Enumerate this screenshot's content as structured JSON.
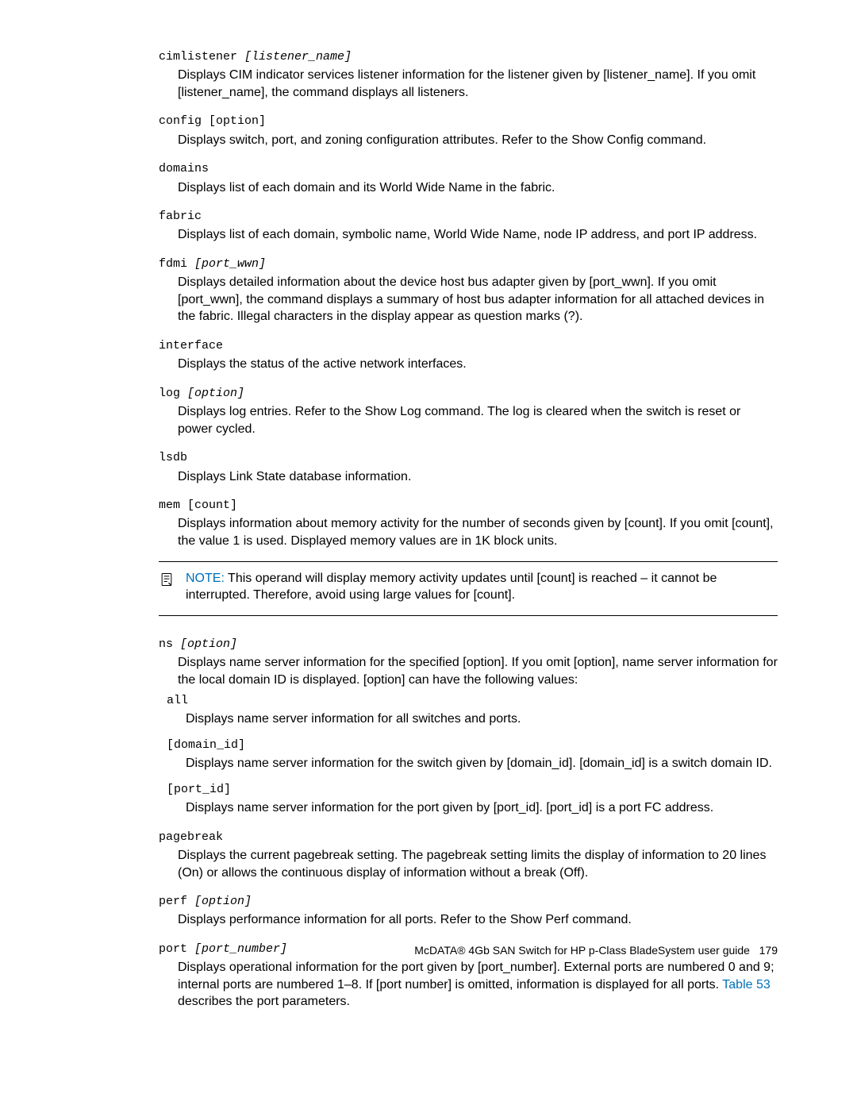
{
  "entries": {
    "cimlistener": {
      "cmd": "cimlistener ",
      "arg": "[listener_name]",
      "desc": "Displays CIM indicator services listener information for the listener given by [listener_name]. If you omit [listener_name], the command displays all listeners."
    },
    "config": {
      "cmd": "config [option]",
      "desc": "Displays switch, port, and zoning configuration attributes. Refer to the Show Config command."
    },
    "domains": {
      "cmd": "domains",
      "desc": "Displays list of each domain and its World Wide Name in the fabric."
    },
    "fabric": {
      "cmd": "fabric",
      "desc": "Displays list of each domain, symbolic name, World Wide Name, node IP address, and port IP address."
    },
    "fdmi": {
      "cmd": "fdmi ",
      "arg": "[port_wwn]",
      "desc": "Displays detailed information about the device host bus adapter given by [port_wwn]. If you omit [port_wwn], the command displays a summary of host bus adapter information for all attached devices in the fabric. Illegal characters in the display appear as question marks (?)."
    },
    "interface": {
      "cmd": "interface",
      "desc": "Displays the status of the active network interfaces."
    },
    "log": {
      "cmd": "log ",
      "arg": "[option]",
      "desc": "Displays log entries. Refer to the Show Log command. The log is cleared when the switch is reset or power cycled."
    },
    "lsdb": {
      "cmd": "lsdb",
      "desc": "Displays Link State database information."
    },
    "mem": {
      "cmd": "mem [count]",
      "desc": "Displays information about memory activity for the number of seconds given by [count]. If you omit [count], the value 1 is used. Displayed memory values are in 1K block units."
    },
    "ns": {
      "cmd": "ns ",
      "arg": "[option]",
      "desc": "Displays name server information for the specified [option]. If you omit [option], name server information for the local domain ID is displayed. [option] can have the following values:",
      "sub": {
        "all": {
          "cmd": "all",
          "desc": "Displays name server information for all switches and ports."
        },
        "domain_id": {
          "cmd": "[domain_id]",
          "desc": "Displays name server information for the switch given by [domain_id]. [domain_id] is a switch domain ID."
        },
        "port_id": {
          "cmd": "[port_id]",
          "desc": "Displays name server information for the port given by [port_id]. [port_id] is a port FC address."
        }
      }
    },
    "pagebreak": {
      "cmd": "pagebreak",
      "desc": "Displays the current pagebreak setting. The pagebreak setting limits the display of information to 20 lines (On) or allows the continuous display of information without a break (Off)."
    },
    "perf": {
      "cmd": "perf ",
      "arg": "[option]",
      "desc": "Displays performance information for all ports. Refer to the Show Perf command."
    },
    "port": {
      "cmd": "port ",
      "arg": "[port_number]",
      "desc_part1": "Displays operational information for the port given by [port_number]. External ports are numbered 0 and 9; internal ports are numbered 1–8. If [port number] is omitted, information is displayed for all ports. ",
      "link": "Table 53",
      "desc_part2": " describes the port parameters."
    }
  },
  "note": {
    "label": "NOTE:",
    "text": "This operand will display memory activity updates until [count] is reached – it cannot be interrupted. Therefore, avoid using large values for [count]."
  },
  "footer": {
    "text": "McDATA® 4Gb SAN Switch for HP p-Class BladeSystem user guide",
    "page": "179"
  }
}
